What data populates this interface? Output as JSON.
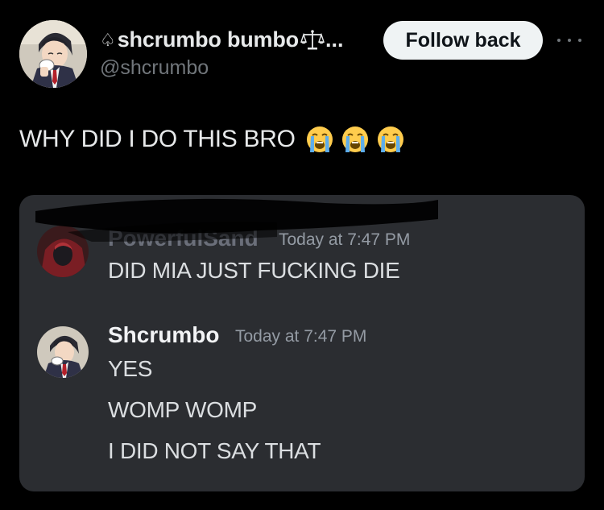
{
  "tweet": {
    "author": {
      "display_name": "shcrumbo bumbo",
      "name_prefix_icon": "spade-icon",
      "name_suffix_icon": "scales-icon",
      "ellipsis": "...",
      "handle": "@shcrumbo",
      "avatar": "avatar-anime-lawyer-drinking-tea"
    },
    "follow_button_label": "Follow back",
    "more_icon": "more-dots-icon",
    "text": "WHY DID I DO THIS BRO",
    "emojis": [
      "loudly-crying-face",
      "loudly-crying-face",
      "loudly-crying-face"
    ]
  },
  "embedded_chat": {
    "background": "#2b2d31",
    "messages": [
      {
        "author": "PowerfulSand",
        "author_redacted": true,
        "time": "Today at 7:47 PM",
        "avatar": "avatar-red-hooded-character",
        "lines": [
          "DID MIA JUST FUCKING DIE"
        ]
      },
      {
        "author": "Shcrumbo",
        "author_redacted": false,
        "time": "Today at 7:47 PM",
        "avatar": "avatar-anime-lawyer-drinking-tea",
        "lines": [
          "YES",
          "WOMP WOMP",
          "I DID NOT SAY THAT"
        ]
      }
    ]
  },
  "colors": {
    "background": "#000000",
    "text_primary": "#e7e9ea",
    "text_secondary": "#71767b",
    "button_bg": "#eff3f4",
    "button_text": "#0f1419",
    "chat_text": "#dbdee1",
    "chat_time": "#949ba4"
  }
}
